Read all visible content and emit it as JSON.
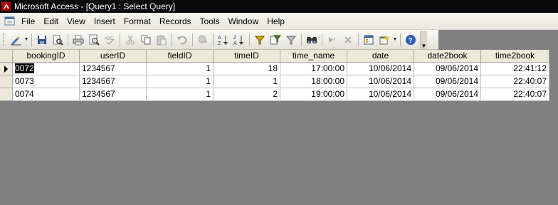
{
  "window": {
    "title": "Microsoft Access - [Query1 : Select Query]"
  },
  "menu": [
    {
      "label": "File",
      "name": "menu-file"
    },
    {
      "label": "Edit",
      "name": "menu-edit"
    },
    {
      "label": "View",
      "name": "menu-view"
    },
    {
      "label": "Insert",
      "name": "menu-insert"
    },
    {
      "label": "Format",
      "name": "menu-format"
    },
    {
      "label": "Records",
      "name": "menu-records"
    },
    {
      "label": "Tools",
      "name": "menu-tools"
    },
    {
      "label": "Window",
      "name": "menu-window"
    },
    {
      "label": "Help",
      "name": "menu-help"
    }
  ],
  "toolbar": {
    "icons": [
      "view-icon",
      "save-icon",
      "file-search-icon",
      "print-icon",
      "print-preview-icon",
      "spelling-icon",
      "cut-icon",
      "copy-icon",
      "paste-icon",
      "undo-icon",
      "hyperlink-icon",
      "sort-ascending-icon",
      "sort-descending-icon",
      "filter-by-selection-icon",
      "filter-by-form-icon",
      "apply-filter-icon",
      "find-icon",
      "new-record-icon",
      "delete-record-icon",
      "database-window-icon",
      "new-object-icon",
      "help-icon"
    ]
  },
  "grid": {
    "columns": [
      "bookingID",
      "userID",
      "fieldID",
      "timeID",
      "time_name",
      "date",
      "date2book",
      "time2book"
    ],
    "rows": [
      [
        "0072",
        "1234567",
        "1",
        "18",
        "17:00:00",
        "10/06/2014",
        "09/06/2014",
        "22:41:12"
      ],
      [
        "0073",
        "1234567",
        "1",
        "1",
        "18:00:00",
        "10/06/2014",
        "09/06/2014",
        "22:40:07"
      ],
      [
        "0074",
        "1234567",
        "1",
        "2",
        "19:00:00",
        "10/06/2014",
        "09/06/2014",
        "22:40:07"
      ]
    ]
  },
  "colors": {
    "titlebar": "#0a0a0a",
    "workspace": "#808080",
    "header": "#ece9d8"
  }
}
